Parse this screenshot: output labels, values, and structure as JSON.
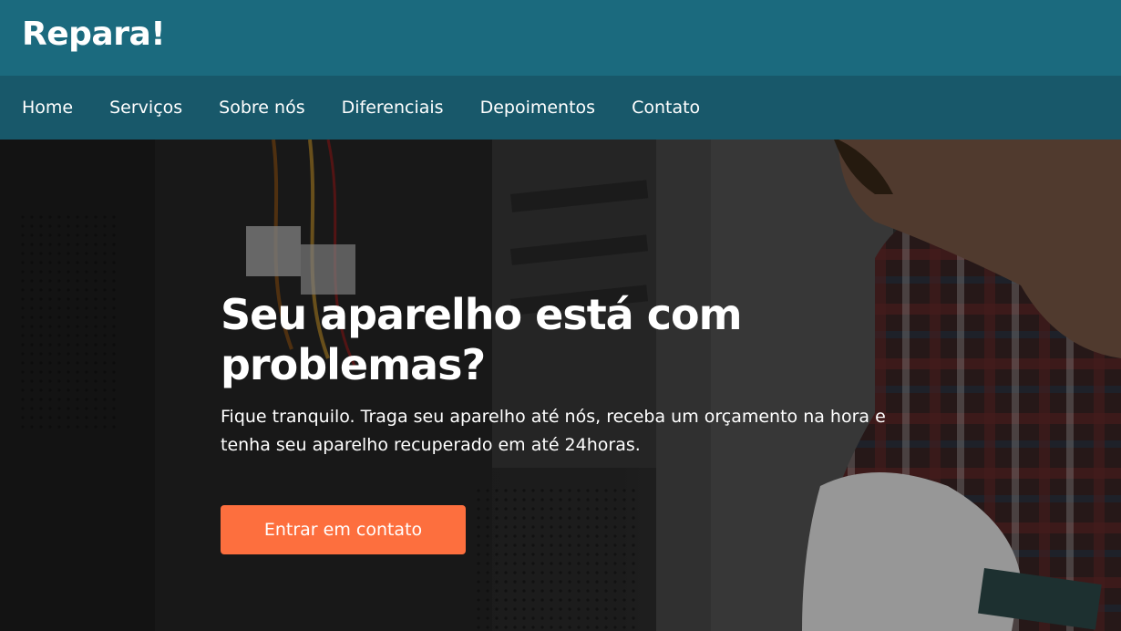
{
  "header": {
    "brand": "Repara!"
  },
  "nav": {
    "items": [
      {
        "label": "Home"
      },
      {
        "label": "Serviços"
      },
      {
        "label": "Sobre nós"
      },
      {
        "label": "Diferenciais"
      },
      {
        "label": "Depoimentos"
      },
      {
        "label": "Contato"
      }
    ]
  },
  "hero": {
    "title": "Seu aparelho está com problemas?",
    "text": "Fique tranquilo. Traga seu aparelho até nós, receba um orçamento na hora e tenha seu aparelho recuperado em até 24horas.",
    "cta_label": "Entrar em contato"
  },
  "colors": {
    "topbar": "#1b6a7e",
    "navbar": "#18586a",
    "accent": "#fd6f3e",
    "text": "#ffffff"
  }
}
